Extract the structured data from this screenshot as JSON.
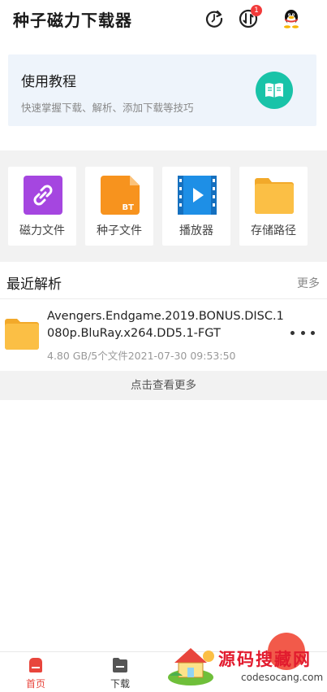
{
  "header": {
    "title": "种子磁力下载器",
    "download_badge": "1"
  },
  "tutorial": {
    "title": "使用教程",
    "subtitle": "快速掌握下载、解析、添加下载等技巧"
  },
  "tools": [
    {
      "label": "磁力文件",
      "icon": "magnet-link-icon",
      "color": "#a546e0"
    },
    {
      "label": "种子文件",
      "icon": "bt-file-icon",
      "badge": "BT",
      "color": "#f7931e"
    },
    {
      "label": "播放器",
      "icon": "player-icon",
      "color": "#1e8fe6"
    },
    {
      "label": "存储路径",
      "icon": "folder-icon",
      "color": "#fbb73c"
    }
  ],
  "recent": {
    "title": "最近解析",
    "more_label": "更多",
    "items": [
      {
        "name": "Avengers.Endgame.2019.BONUS.DISC.1080p.BluRay.x264.DD5.1-FGT",
        "meta": "4.80 GB/5个文件2021-07-30 09:53:50"
      }
    ],
    "see_more_label": "点击查看更多"
  },
  "nav": {
    "items": [
      {
        "label": "首页",
        "active": true,
        "color": "#e8453c"
      },
      {
        "label": "下载",
        "active": false,
        "color": "#444444"
      }
    ]
  },
  "watermark": {
    "text": "源码搜藏网",
    "url": "codesocang.com"
  }
}
